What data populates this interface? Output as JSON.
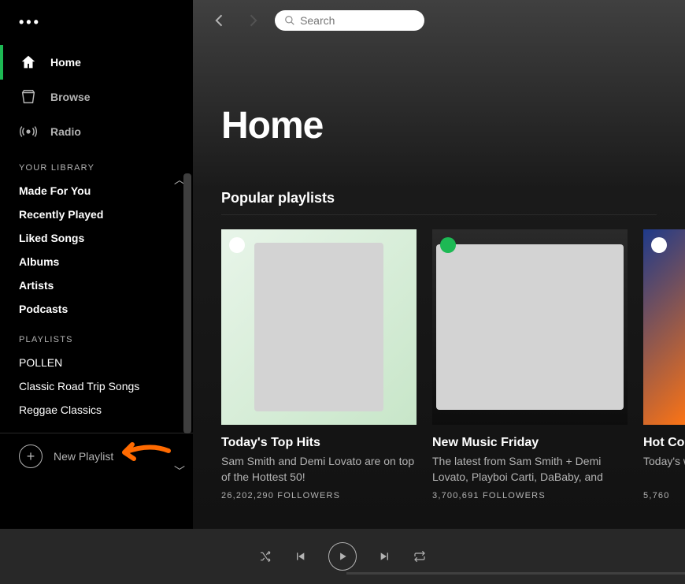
{
  "sidebar": {
    "nav": [
      {
        "label": "Home",
        "active": true
      },
      {
        "label": "Browse",
        "active": false
      },
      {
        "label": "Radio",
        "active": false
      }
    ],
    "library_header": "YOUR LIBRARY",
    "library": [
      "Made For You",
      "Recently Played",
      "Liked Songs",
      "Albums",
      "Artists",
      "Podcasts"
    ],
    "playlists_header": "PLAYLISTS",
    "playlists": [
      "POLLEN",
      "Classic Road Trip Songs",
      "Reggae Classics"
    ],
    "new_playlist": "New Playlist"
  },
  "search": {
    "placeholder": "Search"
  },
  "page": {
    "title": "Home"
  },
  "popular": {
    "header": "Popular playlists",
    "cards": [
      {
        "title": "Today's Top Hits",
        "desc": "Sam Smith and Demi Lovato are on top of the Hottest 50!",
        "followers": "26,202,290 FOLLOWERS"
      },
      {
        "title": "New Music Friday",
        "desc": "The latest from Sam Smith + Demi Lovato, Playboi Carti, DaBaby, and more!",
        "followers": "3,700,691 FOLLOWERS"
      },
      {
        "title": "Hot Country",
        "desc": "Today's week, with Georgia",
        "followers": "5,760"
      }
    ]
  }
}
